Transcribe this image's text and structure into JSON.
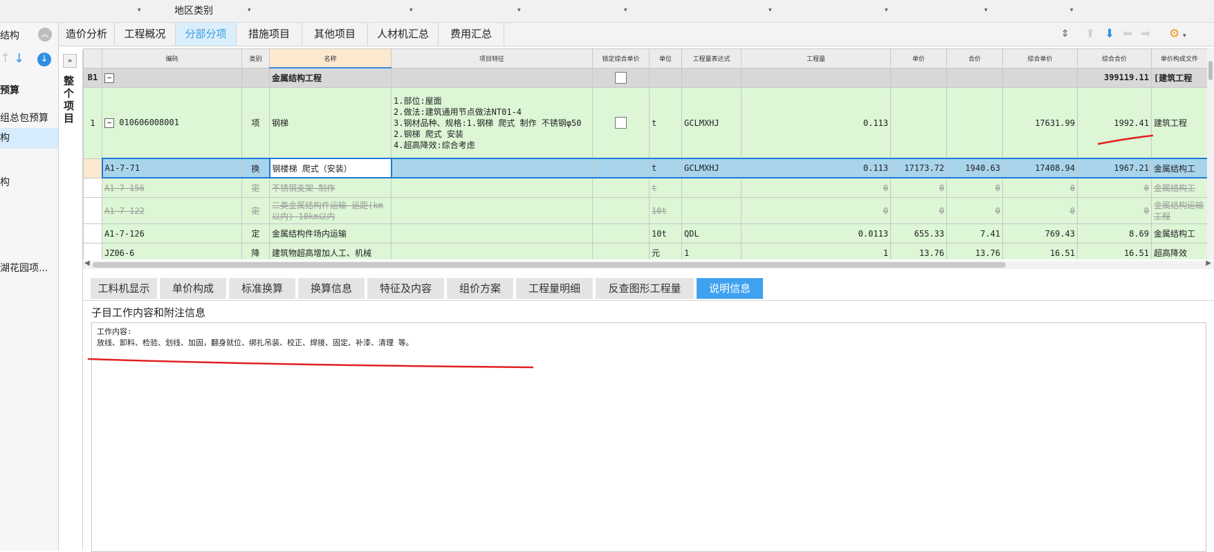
{
  "topbar": {
    "region_label": "地区类别"
  },
  "left_panel": {
    "title": "结构",
    "items": [
      {
        "label": "预算",
        "bold": true
      },
      {
        "label": "组总包预算"
      },
      {
        "label": "构",
        "selected": true
      },
      {
        "label": "构"
      },
      {
        "label": "湖花园项..."
      }
    ]
  },
  "whole_project_label": "整个项目",
  "tabs": [
    {
      "label": "造价分析"
    },
    {
      "label": "工程概况"
    },
    {
      "label": "分部分项",
      "active": true
    },
    {
      "label": "措施项目"
    },
    {
      "label": "其他项目"
    },
    {
      "label": "人材机汇总"
    },
    {
      "label": "费用汇总"
    }
  ],
  "grid": {
    "headers": [
      "编码",
      "类别",
      "名称",
      "项目特征",
      "锁定综合单价",
      "单位",
      "工程量表达式",
      "工程量",
      "单价",
      "合价",
      "综合单价",
      "综合合价",
      "单价构成文件"
    ],
    "section": {
      "code": "B1",
      "name": "金属结构工程",
      "total": "399119.11",
      "file": "[建筑工程"
    },
    "item": {
      "rowno": "1",
      "code": "010606008001",
      "type": "项",
      "name": "钢梯",
      "features": [
        "1.部位:屋面",
        "2.做法:建筑通用节点做法NT01-4",
        "3.钢材品种、规格:1.钢梯 爬式 制作 不锈钢φ50",
        "2.钢梯 爬式 安装",
        "4.超高降效:综合考虑"
      ],
      "unit": "t",
      "expr": "GCLMXHJ",
      "qty": "0.113",
      "unit_price": "",
      "total_price": "",
      "comp_price": "17631.99",
      "comp_total": "1992.41",
      "file": "建筑工程"
    },
    "subitems": [
      {
        "code": "A1-7-71",
        "type": "换",
        "name": "钢楼梯 爬式（安装）",
        "unit": "t",
        "expr": "GCLMXHJ",
        "qty": "0.113",
        "unit_price": "17173.72",
        "total_price": "1940.63",
        "comp_price": "17408.94",
        "comp_total": "1967.21",
        "file": "金属结构工"
      },
      {
        "code": "A1-7-156",
        "type": "定",
        "name": "不锈钢支架 制作",
        "unit": "t",
        "expr": "",
        "qty": "0",
        "unit_price": "0",
        "total_price": "0",
        "comp_price": "0",
        "comp_total": "0",
        "file": "金属结构工"
      },
      {
        "code": "A1-7-122",
        "type": "定",
        "name": "二类金属结构件运输 运距(km以内) 10km以内",
        "unit": "10t",
        "expr": "",
        "qty": "0",
        "unit_price": "0",
        "total_price": "0",
        "comp_price": "0",
        "comp_total": "0",
        "file": "金属结构运输工程"
      },
      {
        "code": "A1-7-126",
        "type": "定",
        "name": "金属结构件场内运输",
        "unit": "10t",
        "expr": "QDL",
        "qty": "0.0113",
        "unit_price": "655.33",
        "total_price": "7.41",
        "comp_price": "769.43",
        "comp_total": "8.69",
        "file": "金属结构工"
      },
      {
        "code": "JZ06-6",
        "type": "降",
        "name": "建筑物超高增加人工、机械",
        "unit": "元",
        "expr": "1",
        "qty": "1",
        "unit_price": "13.76",
        "total_price": "13.76",
        "comp_price": "16.51",
        "comp_total": "16.51",
        "file": "超高降效"
      }
    ]
  },
  "bottom_tabs": [
    {
      "label": "工料机显示"
    },
    {
      "label": "单价构成"
    },
    {
      "label": "标准换算"
    },
    {
      "label": "换算信息"
    },
    {
      "label": "特征及内容"
    },
    {
      "label": "组价方案"
    },
    {
      "label": "工程量明细"
    },
    {
      "label": "反查图形工程量"
    },
    {
      "label": "说明信息",
      "active": true
    }
  ],
  "info": {
    "title": "子目工作内容和附注信息",
    "line1": "工作内容:",
    "line2": "放线、卸料、检验、划线、加固，翻身就位、绑扎吊装、校正、焊接、固定、补漆、清理 等。"
  },
  "colors": {
    "accent": "#3fa2f1",
    "selected_row": "#a8d4ec",
    "green_row": "#dcf6d6",
    "annotation": "#e02020"
  }
}
